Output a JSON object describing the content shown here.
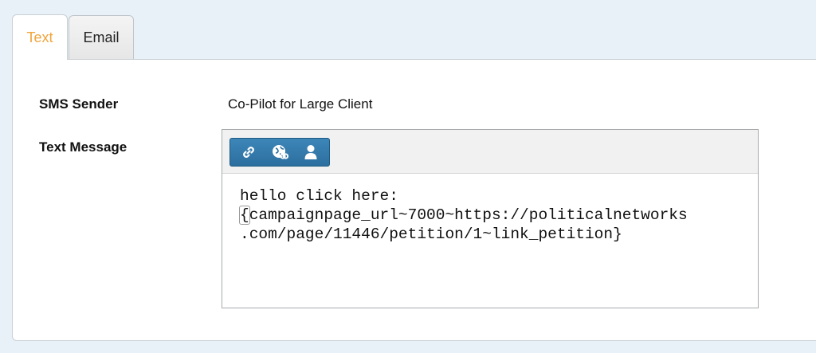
{
  "tabs": [
    {
      "label": "Text",
      "active": true
    },
    {
      "label": "Email",
      "active": false
    }
  ],
  "form": {
    "sms_sender_label": "SMS Sender",
    "sms_sender_value": "Co-Pilot for Large Client",
    "text_message_label": "Text Message"
  },
  "editor": {
    "toolbar_icons": [
      "link-icon",
      "globe-link-icon",
      "user-icon"
    ],
    "line1": "hello click here:",
    "brace_open": "{",
    "line2_rest": "campaignpage_url~7000~https://politicalnetworks",
    "line3": ".com/page/11446/petition/1~link_petition}"
  },
  "colors": {
    "active_tab_text": "#f0a53a",
    "toolbar_button": "#2c6f9f",
    "page_background": "#e8f1f8"
  }
}
